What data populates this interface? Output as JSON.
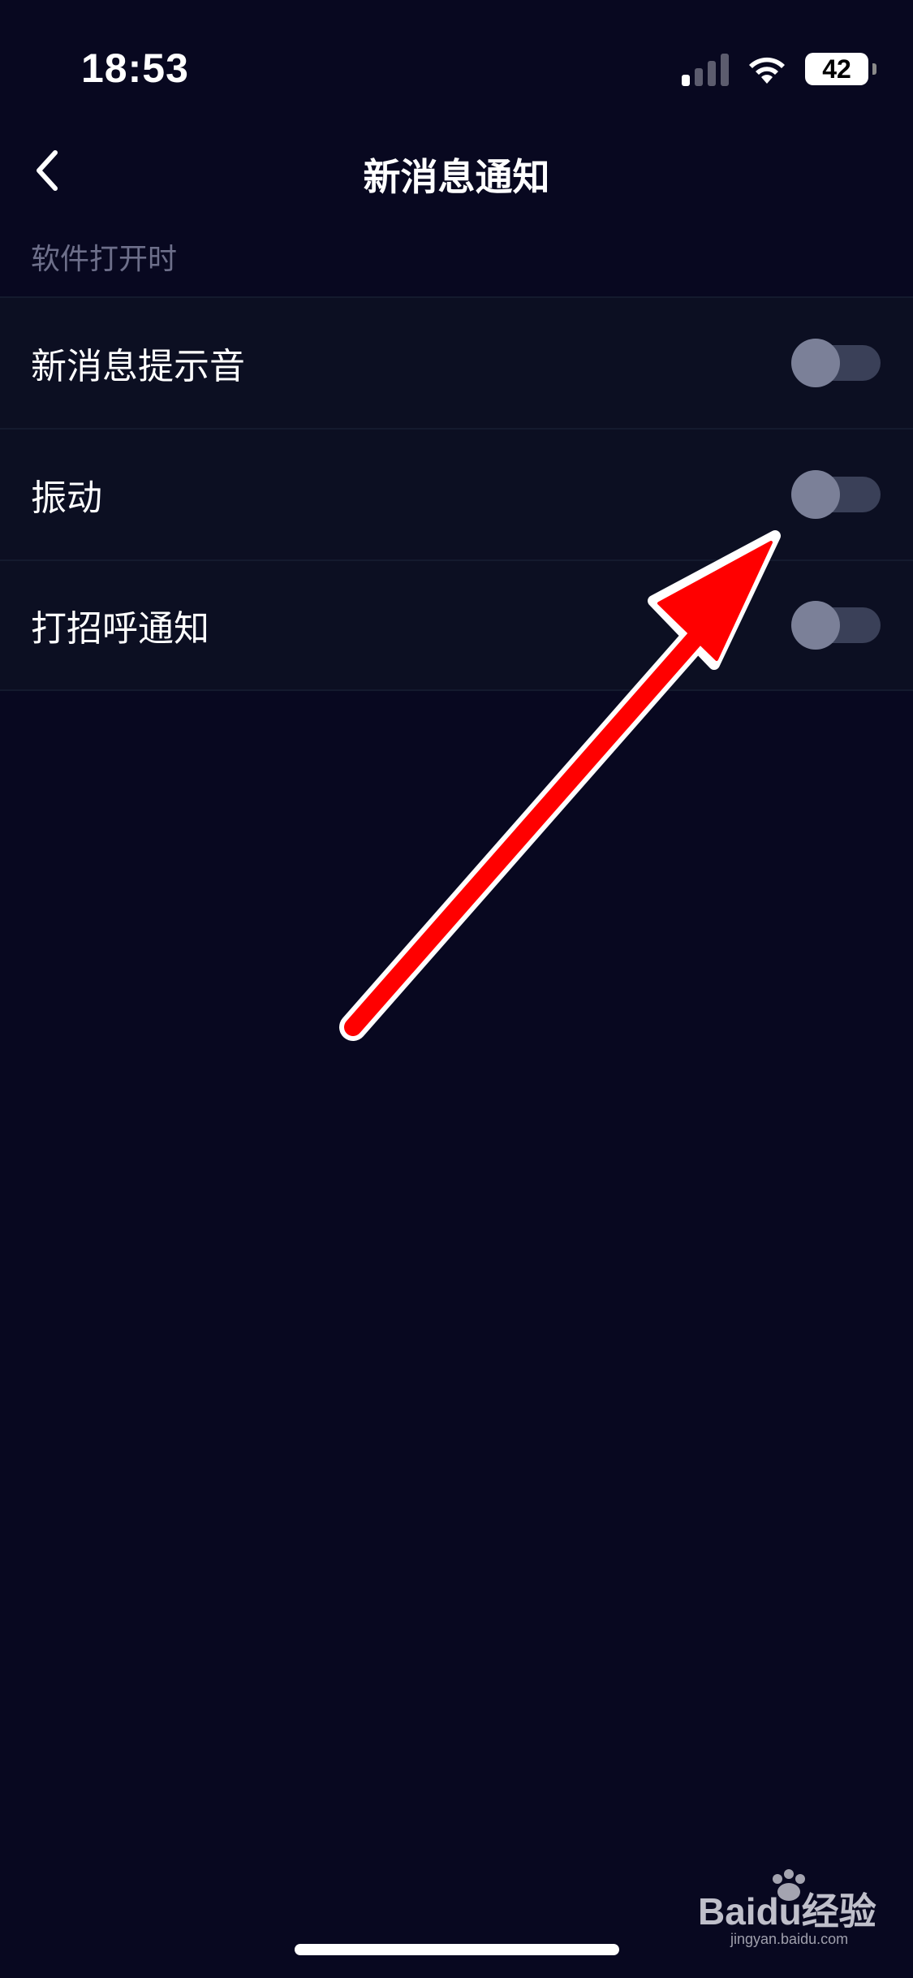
{
  "status_bar": {
    "time": "18:53",
    "battery": "42",
    "icons": [
      "signal-icon",
      "wifi-icon",
      "battery-icon"
    ]
  },
  "nav": {
    "back_icon": "chevron-left-icon",
    "title": "新消息通知"
  },
  "section": {
    "header": "软件打开时"
  },
  "settings": [
    {
      "label": "新消息提示音",
      "enabled": false
    },
    {
      "label": "振动",
      "enabled": false
    },
    {
      "label": "打招呼通知",
      "enabled": false
    }
  ],
  "watermark": {
    "text": "Baidu经验",
    "subtext": "jingyan.baidu.com"
  },
  "colors": {
    "background": "#080820",
    "row_background": "#0c0f22",
    "toggle_track": "#3a4058",
    "toggle_knob": "#7b8098",
    "annotation": "#ff0000"
  }
}
